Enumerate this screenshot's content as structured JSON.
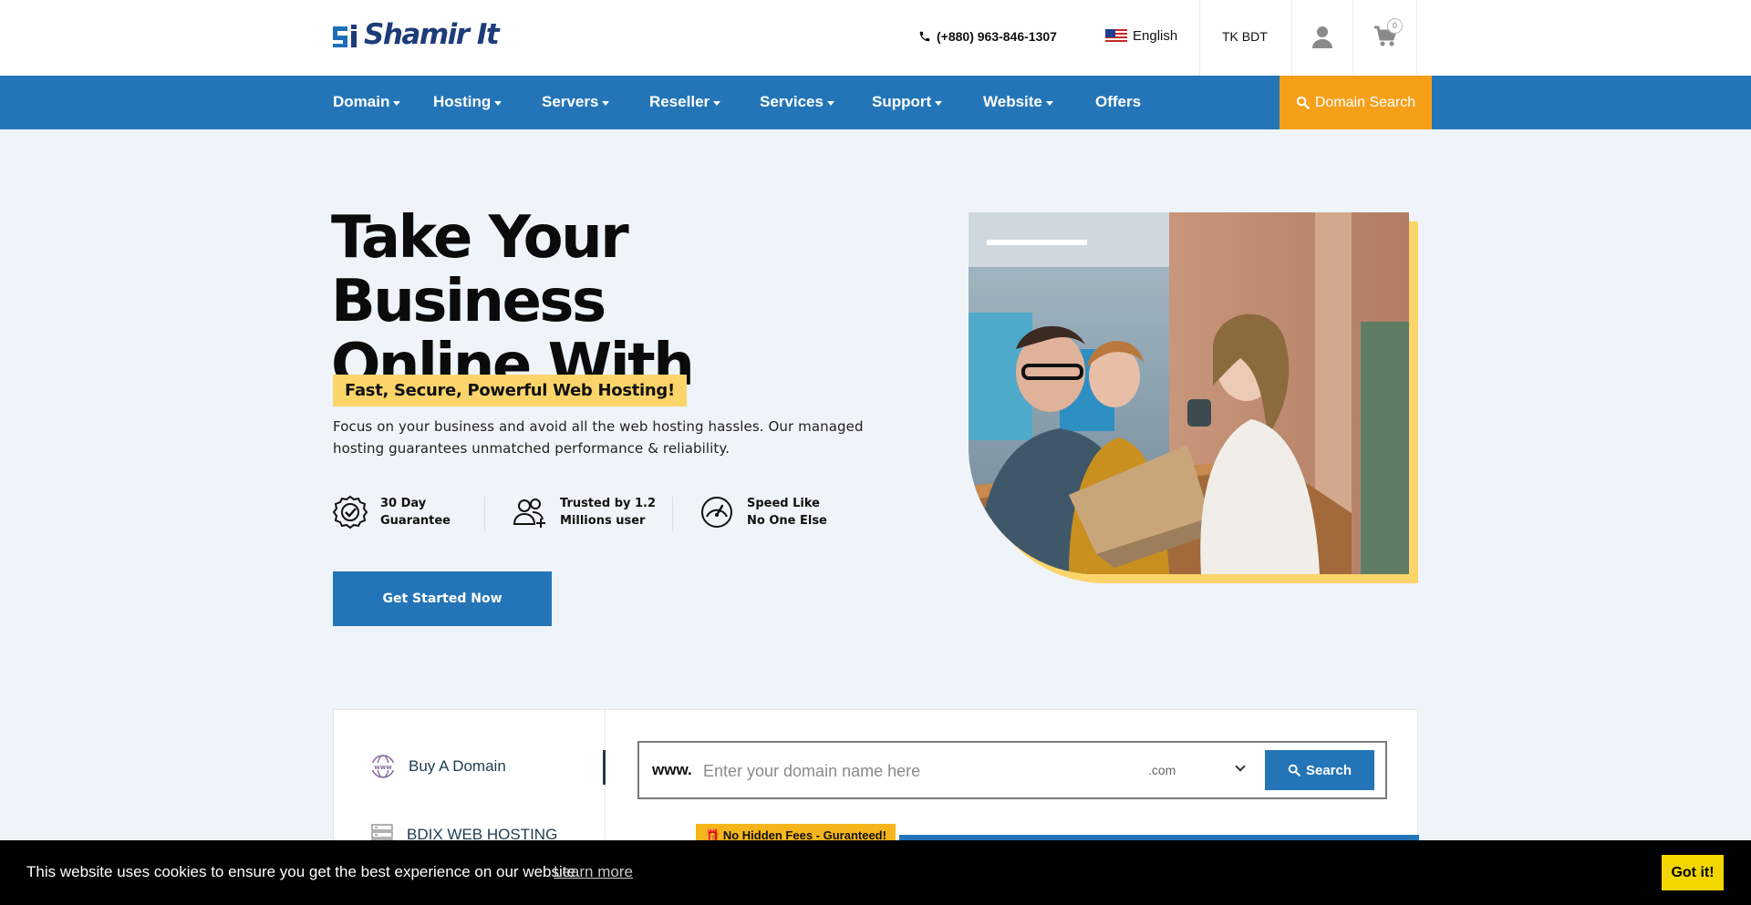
{
  "header": {
    "logo_text": "Shamir It",
    "phone": "(+880) 963-846-1307",
    "language": "English",
    "currency": "TK BDT",
    "cart_count": "0"
  },
  "nav": {
    "items": [
      {
        "label": "Domain",
        "dropdown": true
      },
      {
        "label": "Hosting",
        "dropdown": true
      },
      {
        "label": "Servers",
        "dropdown": true
      },
      {
        "label": "Reseller",
        "dropdown": true
      },
      {
        "label": "Services",
        "dropdown": true
      },
      {
        "label": "Support",
        "dropdown": true
      },
      {
        "label": "Website",
        "dropdown": true
      },
      {
        "label": "Offers",
        "dropdown": false
      }
    ],
    "domain_search_label": "Domain Search"
  },
  "hero": {
    "title_line1": "Take Your Business",
    "title_line2": "Online With",
    "badge": "Fast, Secure, Powerful Web Hosting!",
    "description": "Focus on your business and avoid all the web hosting hassles. Our managed hosting guarantees unmatched performance & reliability.",
    "features": [
      {
        "line1": "30 Day",
        "line2": "Guarantee",
        "icon": "badge-check-icon"
      },
      {
        "line1": "Trusted by 1.2",
        "line2": "Millions user",
        "icon": "users-add-icon"
      },
      {
        "line1": "Speed Like",
        "line2": "No One Else",
        "icon": "speedometer-icon"
      }
    ],
    "cta_label": "Get Started Now"
  },
  "domain_panel": {
    "side_items": [
      {
        "label": "Buy A Domain",
        "icon": "www-globe-icon",
        "active": true
      },
      {
        "label": "BDIX WEB HOSTING",
        "icon": "server-icon",
        "active": false
      }
    ],
    "www_prefix": "www.",
    "input_placeholder": "Enter your domain name here",
    "tld_selected": ".com",
    "search_label": "Search",
    "no_fees_label": "No Hidden Fees - Guranteed!"
  },
  "cookie": {
    "message": "This website uses cookies to ensure you get the best experience on our website.",
    "learn_more": "Learn more",
    "accept_label": "Got it!"
  },
  "colors": {
    "primary": "#2475b7",
    "accent_orange": "#f6a01a",
    "accent_yellow": "#fcd56a",
    "cookie_button": "#f1d600"
  }
}
